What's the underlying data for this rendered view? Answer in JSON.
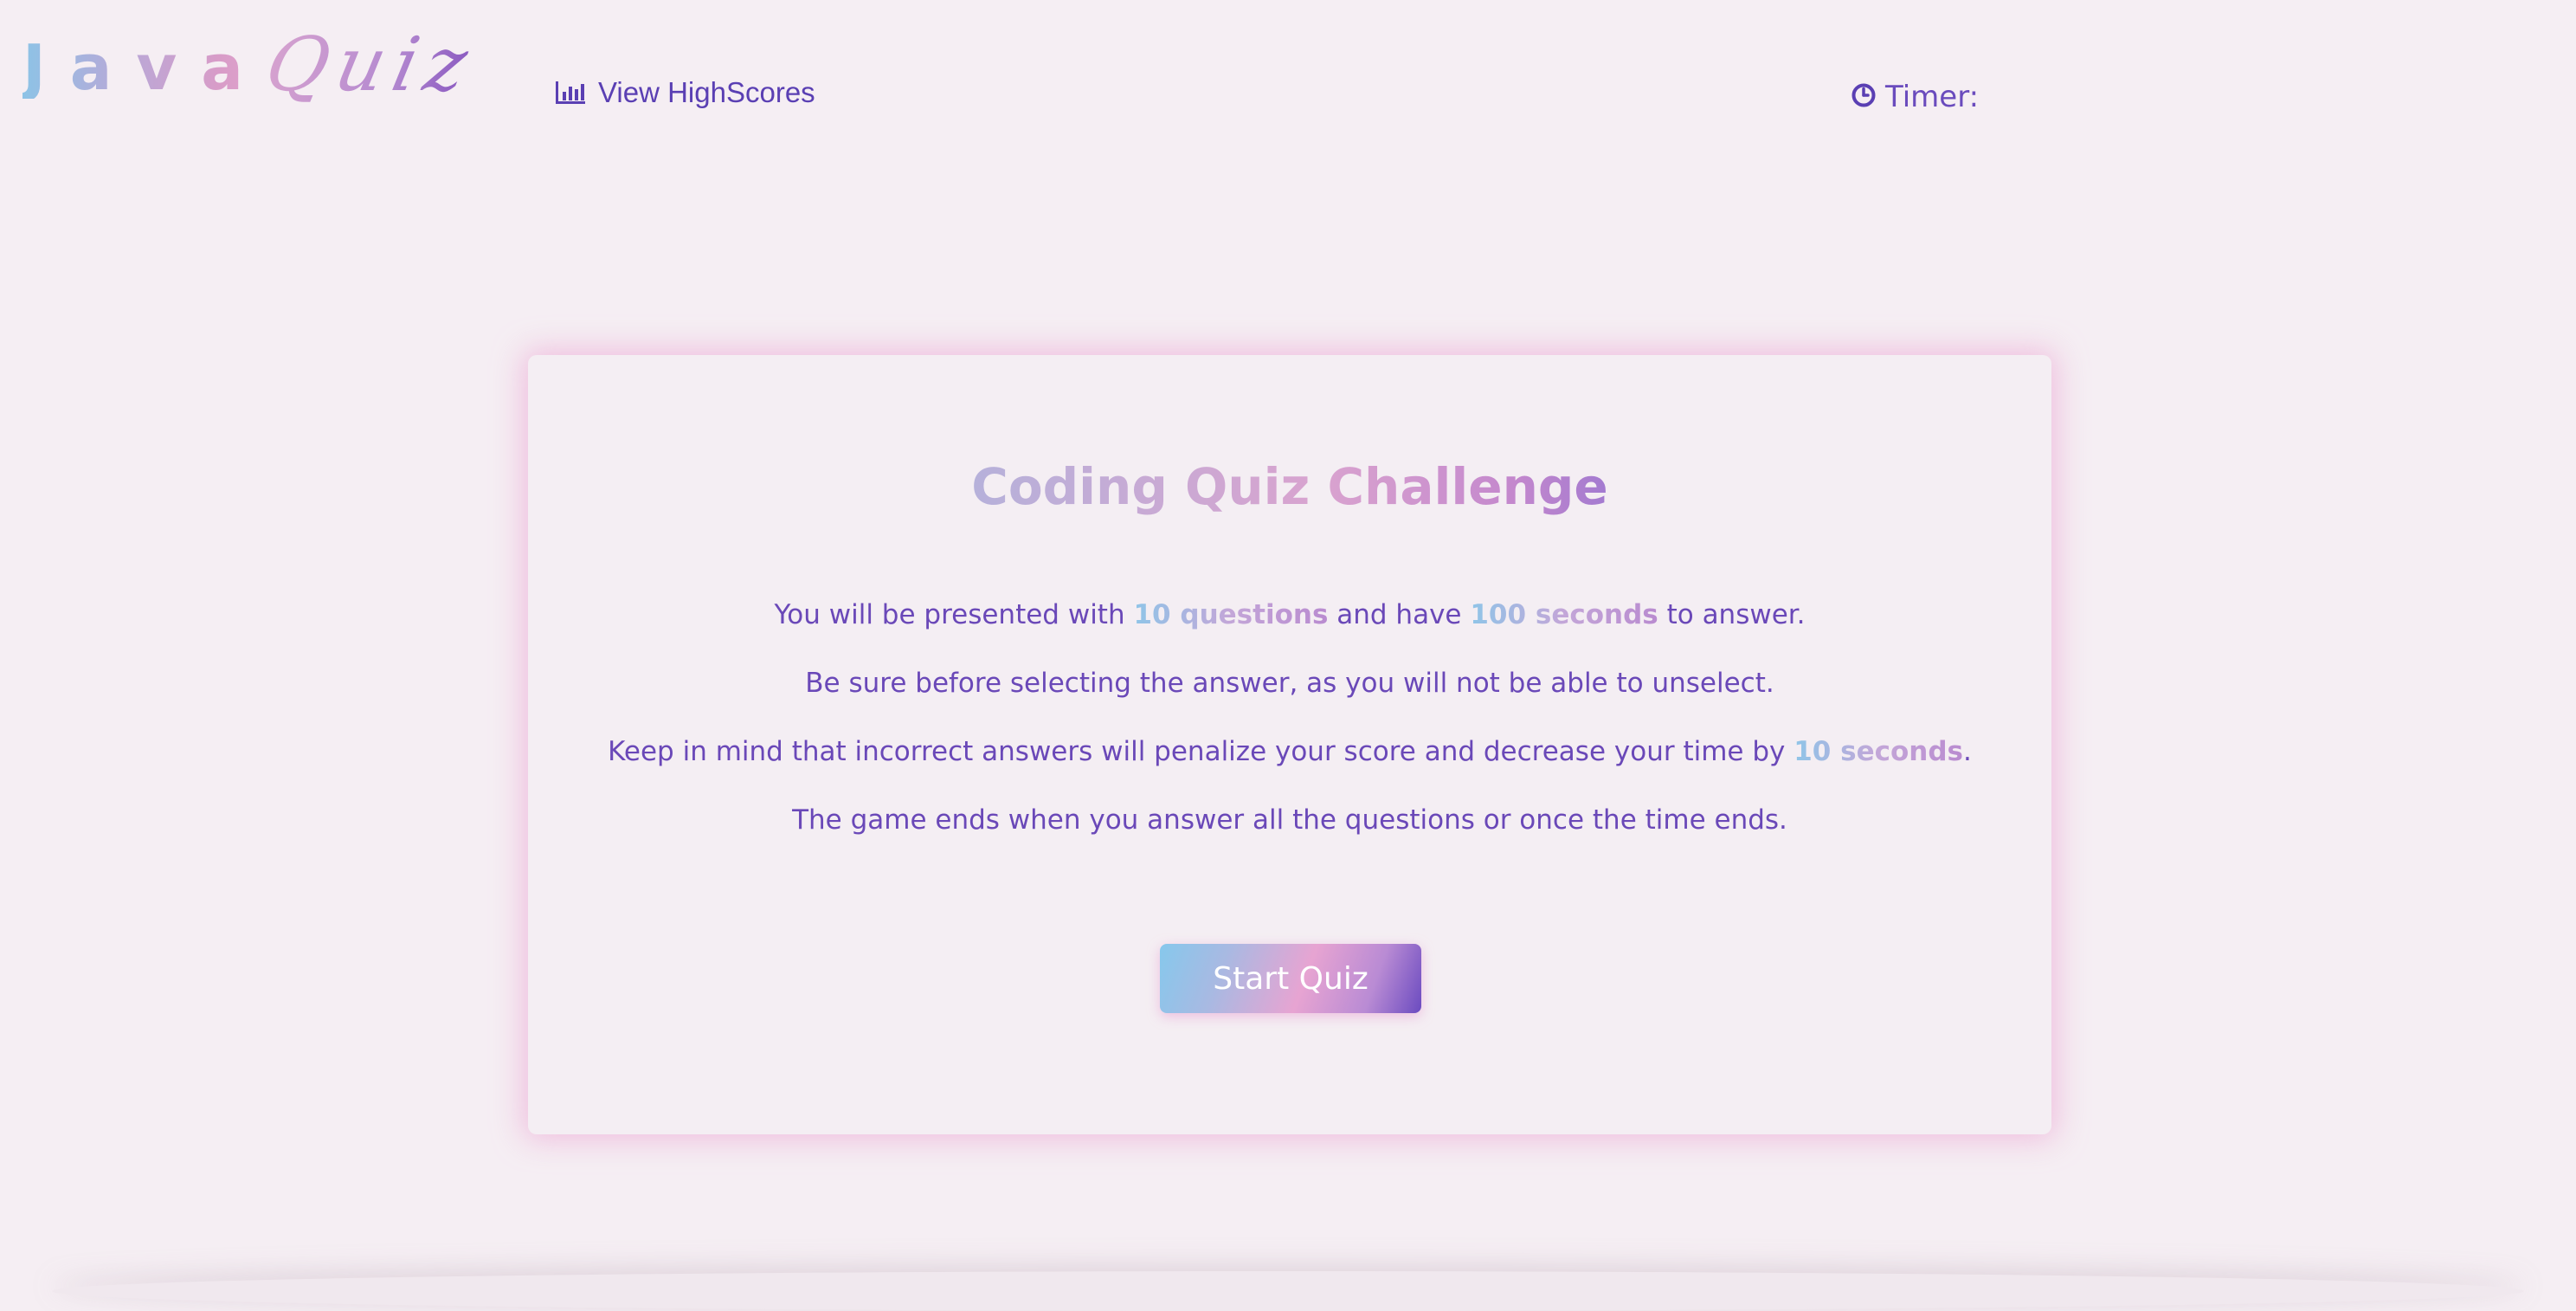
{
  "header": {
    "logo": {
      "part1": "Java",
      "part2": "Quiz"
    },
    "highscores_label": "View HighScores",
    "timer_label": "Timer:"
  },
  "card": {
    "title": "Coding Quiz Challenge",
    "rule1": {
      "before": "You will be presented with ",
      "hl1": "10 questions",
      "middle": " and have ",
      "hl2": "100 seconds",
      "after": " to answer."
    },
    "rule2": "Be sure before selecting the answer, as you will not be able to unselect.",
    "rule3": {
      "before": "Keep in mind that incorrect answers will penalize your score and decrease your time by ",
      "hl": "10 seconds",
      "after": "."
    },
    "rule4": "The game ends when you answer all the questions or once the time ends.",
    "start_button": "Start Quiz"
  },
  "icons": {
    "highscores": "bar-chart-icon",
    "timer": "clock-icon"
  },
  "colors": {
    "background": "#f5eef3",
    "text_primary": "#6a48b8",
    "link": "#5a3fb3",
    "card_glow": "#eca6d4",
    "gradient_blue": "#86c8ec",
    "gradient_pink": "#e7a4d2",
    "gradient_purple": "#6b4bc0"
  }
}
